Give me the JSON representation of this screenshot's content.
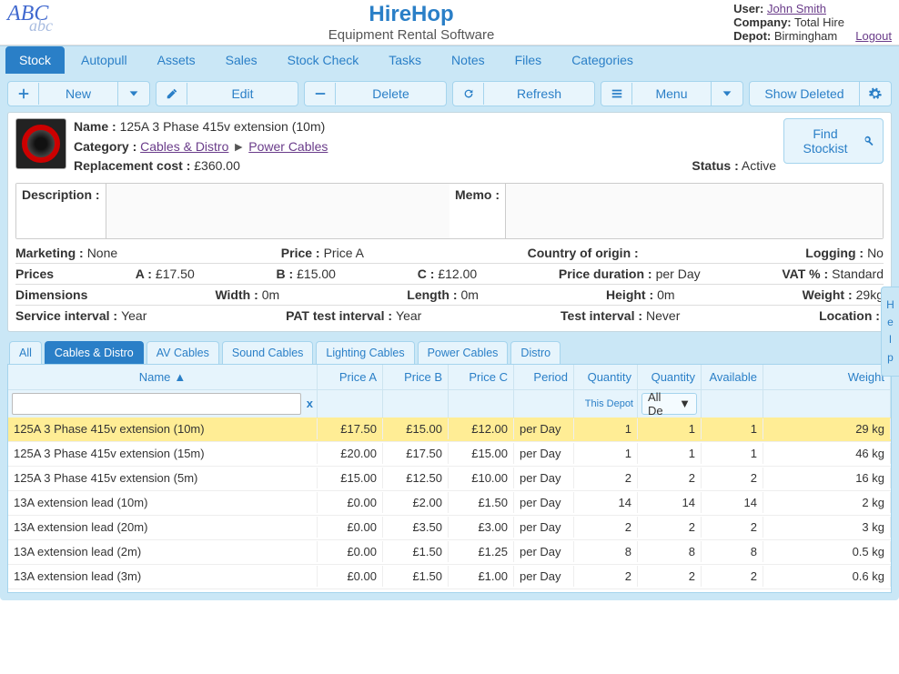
{
  "brand": {
    "logo_line1": "ABC",
    "logo_line2": "abc"
  },
  "title": {
    "main": "HireHop",
    "sub": "Equipment Rental Software"
  },
  "user": {
    "user_lbl": "User:",
    "user": "John Smith",
    "company_lbl": "Company:",
    "company": "Total Hire",
    "depot_lbl": "Depot:",
    "depot": "Birmingham",
    "logout": "Logout"
  },
  "main_tabs": [
    "Stock",
    "Autopull",
    "Assets",
    "Sales",
    "Stock Check",
    "Tasks",
    "Notes",
    "Files",
    "Categories"
  ],
  "main_tab_active": 0,
  "toolbar": {
    "new": "New",
    "edit": "Edit",
    "delete": "Delete",
    "refresh": "Refresh",
    "menu": "Menu",
    "show_deleted": "Show Deleted"
  },
  "detail": {
    "name_lbl": "Name :",
    "name": "125A 3 Phase 415v extension (10m)",
    "cat_lbl": "Category :",
    "cat1": "Cables & Distro",
    "cat2": "Power Cables",
    "repl_lbl": "Replacement cost :",
    "repl": "£360.00",
    "status_lbl": "Status :",
    "status": "Active",
    "find_line1": "Find",
    "find_line2": "Stockist",
    "desc_lbl": "Description :",
    "memo_lbl": "Memo :",
    "marketing_lbl": "Marketing :",
    "marketing": "None",
    "price_lbl": "Price :",
    "price": "Price A",
    "coo_lbl": "Country of origin :",
    "coo": "",
    "logging_lbl": "Logging :",
    "logging": "No",
    "prices_lbl": "Prices",
    "pa_lbl": "A :",
    "pa": "£17.50",
    "pb_lbl": "B :",
    "pb": "£15.00",
    "pc_lbl": "C :",
    "pc": "£12.00",
    "pdur_lbl": "Price duration :",
    "pdur": "per Day",
    "vat_lbl": "VAT % :",
    "vat": "Standard",
    "dim_lbl": "Dimensions",
    "width_lbl": "Width :",
    "width": "0m",
    "length_lbl": "Length :",
    "length": "0m",
    "height_lbl": "Height :",
    "height": "0m",
    "weight_lbl": "Weight :",
    "weight": "29kg",
    "sint_lbl": "Service interval :",
    "sint": "Year",
    "pat_lbl": "PAT test interval :",
    "pat": "Year",
    "tint_lbl": "Test interval :",
    "tint": "Never",
    "loc_lbl": "Location :",
    "loc": ""
  },
  "sub_tabs": [
    "All",
    "Cables & Distro",
    "AV Cables",
    "Sound Cables",
    "Lighting Cables",
    "Power Cables",
    "Distro"
  ],
  "sub_tab_active": 1,
  "grid": {
    "headers": {
      "name": "Name",
      "pa": "Price A",
      "pb": "Price B",
      "pc": "Price C",
      "period": "Period",
      "qd": "Quantity",
      "qd2": "This Depot",
      "qa": "Quantity",
      "qa_sel": "All De",
      "av": "Available",
      "wt": "Weight",
      "sort": "▲",
      "clear": "x"
    },
    "rows": [
      {
        "name": "125A 3 Phase 415v extension (10m)",
        "pa": "£17.50",
        "pb": "£15.00",
        "pc": "£12.00",
        "period": "per Day",
        "qd": "1",
        "qa": "1",
        "av": "1",
        "wt": "29 kg",
        "sel": true
      },
      {
        "name": "125A 3 Phase 415v extension (15m)",
        "pa": "£20.00",
        "pb": "£17.50",
        "pc": "£15.00",
        "period": "per Day",
        "qd": "1",
        "qa": "1",
        "av": "1",
        "wt": "46 kg"
      },
      {
        "name": "125A 3 Phase 415v extension (5m)",
        "pa": "£15.00",
        "pb": "£12.50",
        "pc": "£10.00",
        "period": "per Day",
        "qd": "2",
        "qa": "2",
        "av": "2",
        "wt": "16 kg"
      },
      {
        "name": "13A extension lead (10m)",
        "pa": "£0.00",
        "pb": "£2.00",
        "pc": "£1.50",
        "period": "per Day",
        "qd": "14",
        "qa": "14",
        "av": "14",
        "wt": "2 kg"
      },
      {
        "name": "13A extension lead (20m)",
        "pa": "£0.00",
        "pb": "£3.50",
        "pc": "£3.00",
        "period": "per Day",
        "qd": "2",
        "qa": "2",
        "av": "2",
        "wt": "3 kg"
      },
      {
        "name": "13A extension lead (2m)",
        "pa": "£0.00",
        "pb": "£1.50",
        "pc": "£1.25",
        "period": "per Day",
        "qd": "8",
        "qa": "8",
        "av": "8",
        "wt": "0.5 kg"
      },
      {
        "name": "13A extension lead (3m)",
        "pa": "£0.00",
        "pb": "£1.50",
        "pc": "£1.00",
        "period": "per Day",
        "qd": "2",
        "qa": "2",
        "av": "2",
        "wt": "0.6 kg"
      }
    ]
  },
  "help_tab": "Help"
}
